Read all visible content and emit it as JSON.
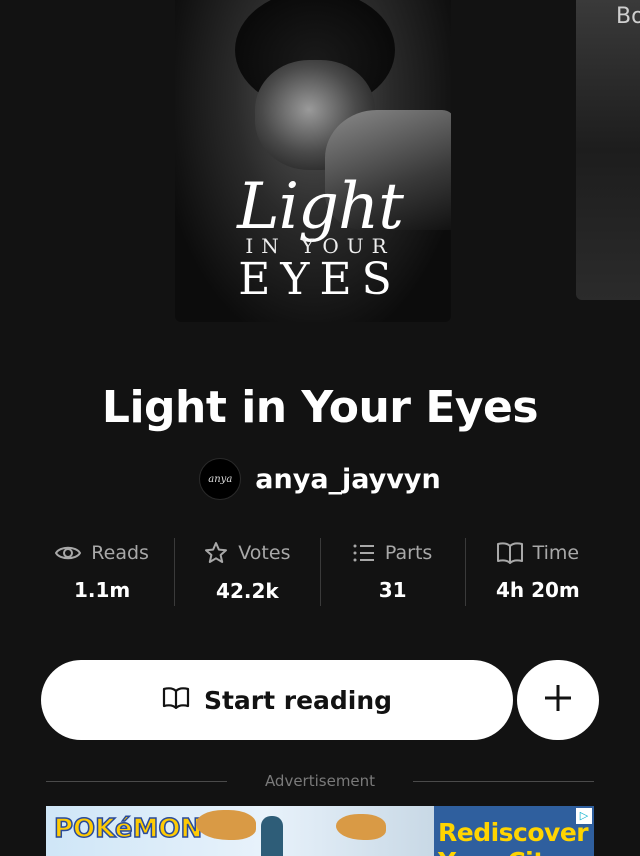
{
  "book": {
    "title": "Light in Your Eyes",
    "author": "anya_jayvyn",
    "cover_text": {
      "line1": "Light",
      "line2": "IN YOUR",
      "line3": "EYES"
    },
    "next_cover_peek": "Bo"
  },
  "stats": [
    {
      "label": "Reads",
      "value": "1.1m",
      "icon": "eye-icon"
    },
    {
      "label": "Votes",
      "value": "42.2k",
      "icon": "star-icon"
    },
    {
      "label": "Parts",
      "value": "31",
      "icon": "list-icon"
    },
    {
      "label": "Time",
      "value": "4h 20m",
      "icon": "book-icon"
    }
  ],
  "actions": {
    "start_reading": "Start reading",
    "add": "+"
  },
  "ad": {
    "divider_label": "Advertisement",
    "brand": "POKéMON",
    "headline": "Rediscover Your City"
  },
  "colors": {
    "background": "#121212",
    "button": "#ffffff",
    "muted": "#a8a8a8"
  }
}
